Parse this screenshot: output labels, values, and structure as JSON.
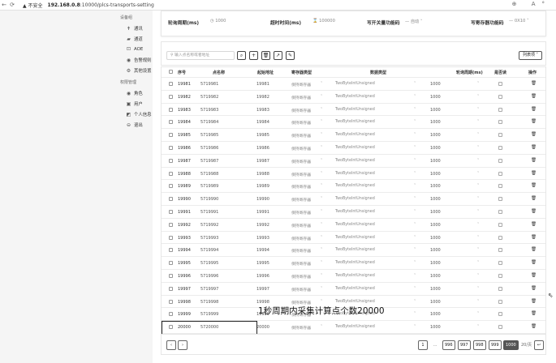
{
  "browser": {
    "back_icon": "←",
    "reload_icon": "⟳",
    "warn_text": "▲ 不安全",
    "url_host": "192.168.0.8",
    "url_rest": ":10000/plcs-transports-setting",
    "right_icons": "⊕ A°"
  },
  "sidebar": {
    "group1": "设备组",
    "items1": [
      {
        "icon": "✝",
        "label": "通讯"
      },
      {
        "icon": "▰",
        "label": "通道"
      },
      {
        "icon": "⊡",
        "label": "AOE"
      },
      {
        "icon": "◉",
        "label": "告警规则"
      },
      {
        "icon": "⚙",
        "label": "其他设置"
      }
    ],
    "group2": "权限管理",
    "items2": [
      {
        "icon": "◉",
        "label": "角色"
      },
      {
        "icon": "▣",
        "label": "用户"
      },
      {
        "icon": "◩",
        "label": "个人信息"
      },
      {
        "icon": "⊖",
        "label": "退出"
      }
    ]
  },
  "header": {
    "poll_label": "轮询周期(ms)",
    "poll_value": "1000",
    "timeout_label": "超时时间(ms)",
    "timeout_value": "100000",
    "write_label": "写开关量功能码",
    "write_value": "自动",
    "store_label": "写寄存器功能码",
    "store_value": "0X10"
  },
  "toolbar": {
    "search_placeholder": "输入点名称或者地址",
    "btn_search": "⌕",
    "btn_add": "+",
    "btn_del": "🗑",
    "btn_link": "↗",
    "btn_edit": "✎",
    "columns": "列表项"
  },
  "table": {
    "headers": [
      "序号",
      "点名称",
      "起始地址",
      "寄存器类型",
      "数据类型",
      "轮询周期(ms)",
      "是否读",
      "操作"
    ],
    "register_type": "保持寄存器",
    "data_type": "TwoByteIntUnsigned",
    "rows": [
      {
        "no": "19981",
        "name": "5719981",
        "addr": "19981",
        "period": "1000"
      },
      {
        "no": "19982",
        "name": "5719982",
        "addr": "19982",
        "period": "1000"
      },
      {
        "no": "19983",
        "name": "5719983",
        "addr": "19983",
        "period": "1000"
      },
      {
        "no": "19984",
        "name": "5719984",
        "addr": "19984",
        "period": "1000"
      },
      {
        "no": "19985",
        "name": "5719985",
        "addr": "19985",
        "period": "1000"
      },
      {
        "no": "19986",
        "name": "5719986",
        "addr": "19986",
        "period": "1000"
      },
      {
        "no": "19987",
        "name": "5719987",
        "addr": "19987",
        "period": "1000"
      },
      {
        "no": "19988",
        "name": "5719988",
        "addr": "19988",
        "period": "1000"
      },
      {
        "no": "19989",
        "name": "5719989",
        "addr": "19989",
        "period": "1000"
      },
      {
        "no": "19990",
        "name": "5719990",
        "addr": "19990",
        "period": "1000"
      },
      {
        "no": "19991",
        "name": "5719991",
        "addr": "19991",
        "period": "1000"
      },
      {
        "no": "19992",
        "name": "5719992",
        "addr": "19992",
        "period": "1000"
      },
      {
        "no": "19993",
        "name": "5719993",
        "addr": "19993",
        "period": "1000"
      },
      {
        "no": "19994",
        "name": "5719994",
        "addr": "19994",
        "period": "1000"
      },
      {
        "no": "19995",
        "name": "5719995",
        "addr": "19995",
        "period": "1000"
      },
      {
        "no": "19996",
        "name": "5719996",
        "addr": "19996",
        "period": "1000"
      },
      {
        "no": "19997",
        "name": "5719997",
        "addr": "19997",
        "period": "1000"
      },
      {
        "no": "19998",
        "name": "5719998",
        "addr": "19998",
        "period": "1000"
      },
      {
        "no": "19999",
        "name": "5719999",
        "addr": "19999",
        "period": "1000"
      },
      {
        "no": "20000",
        "name": "5720000",
        "addr": "20000",
        "period": "1000"
      }
    ]
  },
  "overlay_text": "1秒周期内采集计算点个数20000",
  "pagination": {
    "prev": "‹",
    "next": "›",
    "first": "1",
    "ellipsis": "...",
    "pages": [
      "996",
      "997",
      "998",
      "999",
      "1000"
    ],
    "current": "1000",
    "size": "20/页",
    "jump": "↩"
  }
}
